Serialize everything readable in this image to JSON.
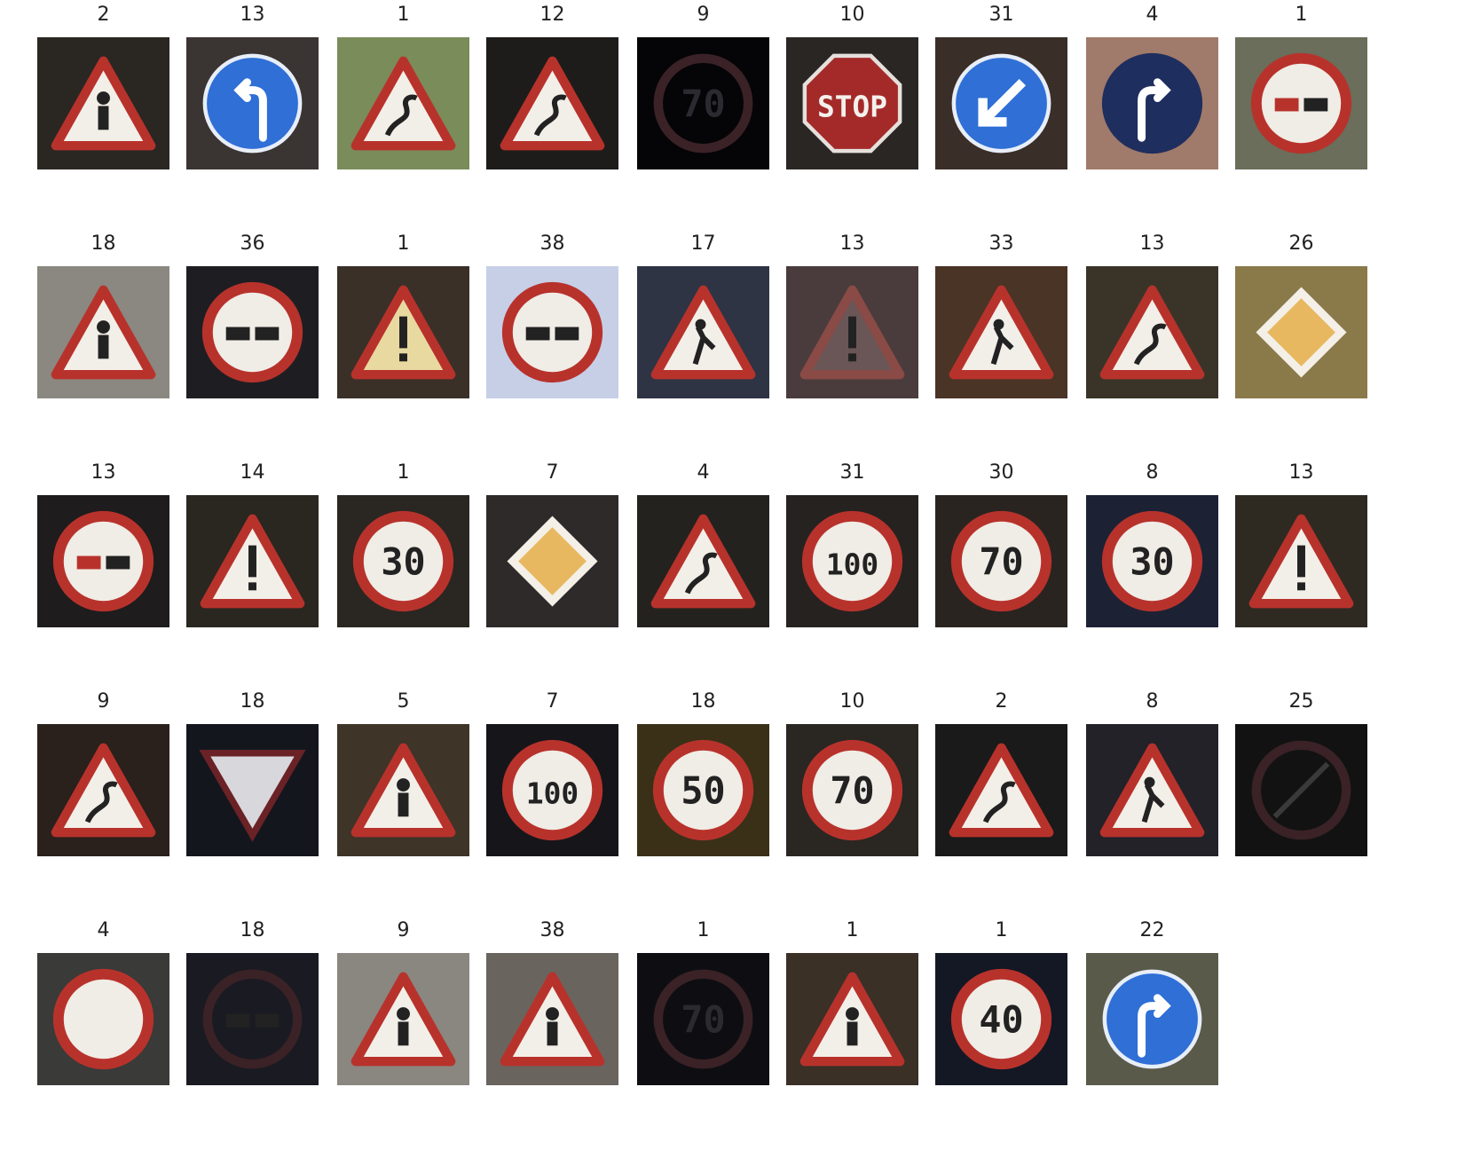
{
  "figure": {
    "rows": [
      [
        "2",
        "13",
        "1",
        "12",
        "9",
        "10",
        "31",
        "4",
        "1"
      ],
      [
        "18",
        "36",
        "1",
        "38",
        "17",
        "13",
        "33",
        "13",
        "26"
      ],
      [
        "13",
        "14",
        "1",
        "7",
        "4",
        "31",
        "30",
        "8",
        "13"
      ],
      [
        "9",
        "18",
        "5",
        "7",
        "18",
        "10",
        "2",
        "8",
        "25"
      ],
      [
        "4",
        "18",
        "9",
        "38",
        "1",
        "1",
        "1",
        "22"
      ]
    ],
    "tiles": [
      [
        {
          "bg": "#2a2622",
          "shape": "triangle",
          "inner": "figure"
        },
        {
          "bg": "#3a3432",
          "shape": "circle-blue",
          "inner": "turn-left"
        },
        {
          "bg": "#7a8c5a",
          "shape": "triangle",
          "inner": "curve"
        },
        {
          "bg": "#1e1c1a",
          "shape": "triangle",
          "inner": "curve"
        },
        {
          "bg": "#050407",
          "shape": "circle-dark",
          "inner": "70"
        },
        {
          "bg": "#2a2624",
          "shape": "octagon",
          "inner": "STOP"
        },
        {
          "bg": "#3a2e28",
          "shape": "circle-blue",
          "inner": "arrow-dl"
        },
        {
          "bg": "#a07a6a",
          "shape": "circle-navy",
          "inner": "turn-right"
        },
        {
          "bg": "#6a6e5a",
          "shape": "circle",
          "inner": "no-overtake"
        }
      ],
      [
        {
          "bg": "#8a8880",
          "shape": "triangle",
          "inner": "figure"
        },
        {
          "bg": "#1e1e22",
          "shape": "circle",
          "inner": "no-truck"
        },
        {
          "bg": "#3a3028",
          "shape": "triangle-yellow",
          "inner": "exclam"
        },
        {
          "bg": "#c6cfe6",
          "shape": "circle",
          "inner": "truck"
        },
        {
          "bg": "#2e3444",
          "shape": "triangle",
          "inner": "worker"
        },
        {
          "bg": "#4a3c3c",
          "shape": "triangle-faint",
          "inner": "exclam"
        },
        {
          "bg": "#4a3426",
          "shape": "triangle",
          "inner": "worker"
        },
        {
          "bg": "#3a3428",
          "shape": "triangle",
          "inner": "curve"
        },
        {
          "bg": "#8a7a4a",
          "shape": "diamond",
          "inner": ""
        }
      ],
      [
        {
          "bg": "#1e1c1c",
          "shape": "circle",
          "inner": "no-overtake"
        },
        {
          "bg": "#2a2620",
          "shape": "triangle",
          "inner": "exclam"
        },
        {
          "bg": "#2a2622",
          "shape": "circle",
          "inner": "30"
        },
        {
          "bg": "#2e2a2a",
          "shape": "diamond",
          "inner": ""
        },
        {
          "bg": "#24221e",
          "shape": "triangle",
          "inner": "slippery"
        },
        {
          "bg": "#262220",
          "shape": "circle",
          "inner": "100"
        },
        {
          "bg": "#2a2420",
          "shape": "circle",
          "inner": "70"
        },
        {
          "bg": "#1c2234",
          "shape": "circle",
          "inner": "30"
        },
        {
          "bg": "#2e2a22",
          "shape": "triangle",
          "inner": "exclam"
        }
      ],
      [
        {
          "bg": "#2a201c",
          "shape": "triangle",
          "inner": "curve"
        },
        {
          "bg": "#14161e",
          "shape": "yield",
          "inner": ""
        },
        {
          "bg": "#3e3428",
          "shape": "triangle",
          "inner": "figure"
        },
        {
          "bg": "#16161a",
          "shape": "circle",
          "inner": "100"
        },
        {
          "bg": "#3a3018",
          "shape": "circle",
          "inner": "50"
        },
        {
          "bg": "#2a2622",
          "shape": "circle",
          "inner": "70"
        },
        {
          "bg": "#1a1a1a",
          "shape": "triangle",
          "inner": "curve"
        },
        {
          "bg": "#222228",
          "shape": "triangle",
          "inner": "worker"
        },
        {
          "bg": "#121212",
          "shape": "circle-dark",
          "inner": "end"
        }
      ],
      [
        {
          "bg": "#3a3a38",
          "shape": "circle",
          "inner": ""
        },
        {
          "bg": "#1a1a22",
          "shape": "circle-dark",
          "inner": "no-truck"
        },
        {
          "bg": "#8a8680",
          "shape": "triangle",
          "inner": "children"
        },
        {
          "bg": "#6a645e",
          "shape": "triangle",
          "inner": "children"
        },
        {
          "bg": "#0e0e12",
          "shape": "circle-dark",
          "inner": "70"
        },
        {
          "bg": "#3a3026",
          "shape": "triangle",
          "inner": "children"
        },
        {
          "bg": "#141824",
          "shape": "circle",
          "inner": "40"
        },
        {
          "bg": "#5a5a4a",
          "shape": "circle-blue",
          "inner": "turn-right"
        }
      ]
    ]
  }
}
